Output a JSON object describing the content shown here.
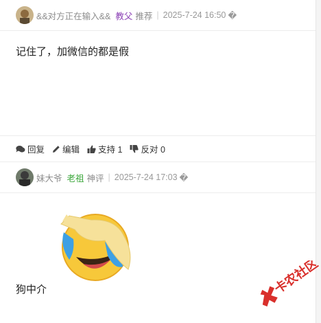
{
  "posts": [
    {
      "author": "&&对方正在输入&&",
      "rank": "教父",
      "rank_color": "#8b3fb5",
      "tag": "推荐",
      "time": "2025-7-24 16:50",
      "location_glyph": "�",
      "content": "记住了，加微信的都是假",
      "actions": {
        "reply": "回复",
        "edit": "编辑",
        "support": "支持 1",
        "oppose": "反对 0"
      }
    },
    {
      "author": "妹大爷",
      "rank": "老祖",
      "rank_color": "#3aa63a",
      "tag": "神评",
      "time": "2025-7-24 17:03",
      "location_glyph": "�",
      "content": "狗中介",
      "image": {
        "icon": "laughing-crying-emoji-icon"
      }
    }
  ],
  "watermark": {
    "text": "卡农社区",
    "color": "#d9302c"
  }
}
